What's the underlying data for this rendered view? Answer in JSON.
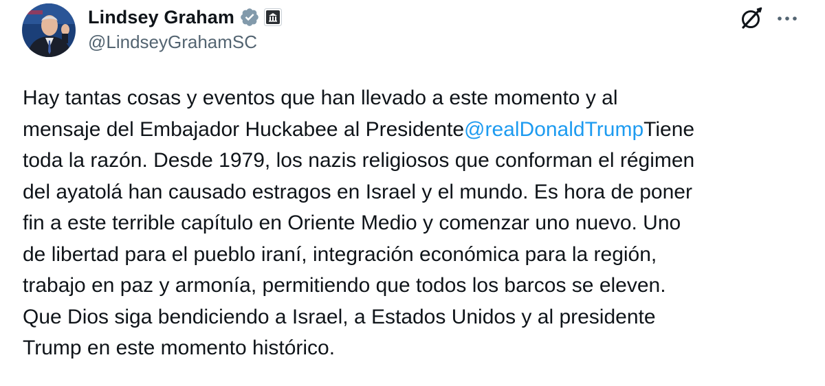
{
  "author": {
    "display_name": "Lindsey Graham",
    "handle": "@LindseyGrahamSC",
    "verified_badge": "verified-badge-icon",
    "affiliation_badge": "government-building-icon",
    "avatar": "profile-photo"
  },
  "actions": {
    "grok_icon": "grok-icon",
    "more_icon": "more-options-icon"
  },
  "tweet": {
    "text_part1": "Hay tantas cosas y eventos que han llevado a este momento y al\nmensaje del Embajador Huckabee al Presidente",
    "mention": "@realDonaldTrump",
    "text_part2": "Tiene\ntoda la razón. Desde 1979, los nazis religiosos que conforman el régimen\ndel ayatolá han causado estragos en Israel y el mundo. Es hora de poner\nfin a este terrible capítulo en Oriente Medio y comenzar uno nuevo. Uno\nde libertad para el pueblo iraní, integración económica para la región,\ntrabajo en paz y armonía, permitiendo que todos los barcos se eleven.\nQue Dios siga bendiciendo a Israel, a Estados Unidos y al presidente\nTrump en este momento histórico."
  },
  "colors": {
    "text": "#0f1419",
    "secondary": "#536471",
    "link": "#1d9bf0",
    "verified_gray": "#829aab"
  }
}
